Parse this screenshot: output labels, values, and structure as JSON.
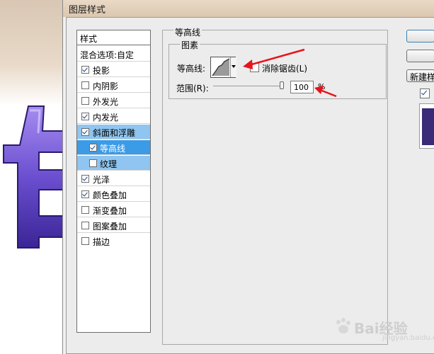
{
  "window": {
    "title": "图层样式"
  },
  "style_list": {
    "header": "样式",
    "blend_options": "混合选项:自定",
    "items": [
      {
        "label": "投影",
        "checked": true
      },
      {
        "label": "内阴影",
        "checked": false
      },
      {
        "label": "外发光",
        "checked": false
      },
      {
        "label": "内发光",
        "checked": true
      },
      {
        "label": "斜面和浮雕",
        "checked": true
      },
      {
        "label": "等高线",
        "checked": true
      },
      {
        "label": "纹理",
        "checked": false
      },
      {
        "label": "光泽",
        "checked": true
      },
      {
        "label": "颜色叠加",
        "checked": true
      },
      {
        "label": "渐变叠加",
        "checked": false
      },
      {
        "label": "图案叠加",
        "checked": false
      },
      {
        "label": "描边",
        "checked": false
      }
    ]
  },
  "contour_panel": {
    "group_title": "等高线",
    "subgroup_title": "图素",
    "contour_label": "等高线:",
    "anti_alias_label": "消除锯齿(L)",
    "range_label": "范围(R):",
    "range_value": "100",
    "range_unit": "%",
    "range_fraction": 1.0
  },
  "right_panel": {
    "new_style_label": "新建样"
  },
  "watermark": {
    "text": "Bai经验",
    "sub": "jingyan.baidu.com"
  },
  "colors": {
    "selection": "#3c9be6",
    "selection_light": "#8fc5f0",
    "annotation_arrow": "#e8141b",
    "letter_purple": "#6b4fd0"
  },
  "icons": {
    "contour_preview": "contour-curve-icon",
    "dropdown": "triangle-down-icon",
    "arrows": "red-arrow-icon"
  }
}
